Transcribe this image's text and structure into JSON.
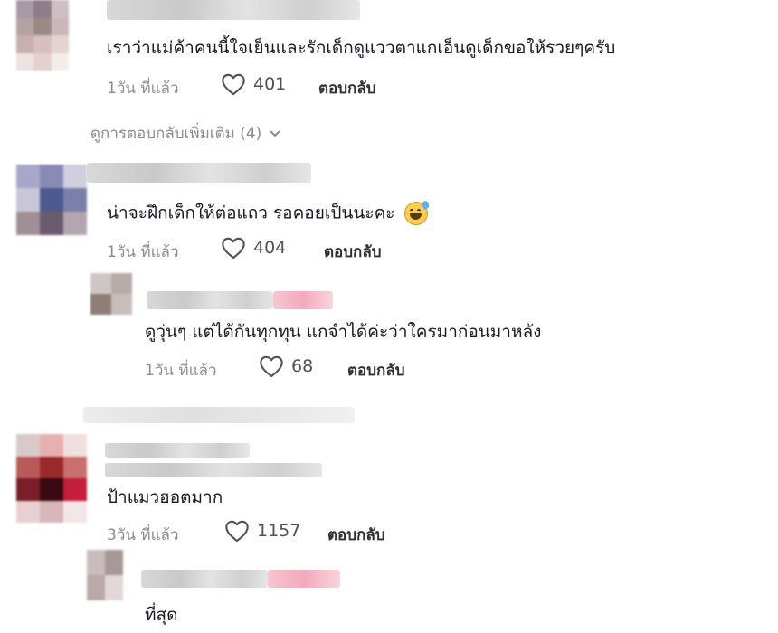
{
  "comments": [
    {
      "text": "เราว่าแม่ค้าคนนี้ใจเย็นและรักเด็กดูแววตาแกเอ็นดูเด็กขอให้รวยๆครับ",
      "time": "1วัน ที่แล้ว",
      "likes": "401",
      "reply_label": "ตอบกลับ"
    },
    {
      "text": "น่าจะฝึกเด็กให้ต่อแถว รอคอยเป็นนะคะ",
      "emoji": "sweat-smile-emoji",
      "time": "1วัน ที่แล้ว",
      "likes": "404",
      "reply_label": "ตอบกลับ"
    },
    {
      "text": "ดูวุ่นๆ แต่ได้กันทุกทุน แกจำได้ค่ะว่าใครมาก่อนมาหลัง",
      "time": "1วัน ที่แล้ว",
      "likes": "68",
      "reply_label": "ตอบกลับ"
    },
    {
      "text": "ป้าแมวฮอตมาก",
      "time": "3วัน ที่แล้ว",
      "likes": "1157",
      "reply_label": "ตอบกลับ"
    },
    {
      "text": "ที่สุด"
    }
  ],
  "view_more": {
    "label": "ดูการตอบกลับเพิ่มเติม (4)",
    "icon": "chevron-down-icon"
  },
  "colors": {
    "text": "#161823",
    "meta": "#8a8b91",
    "background": "#ffffff"
  }
}
